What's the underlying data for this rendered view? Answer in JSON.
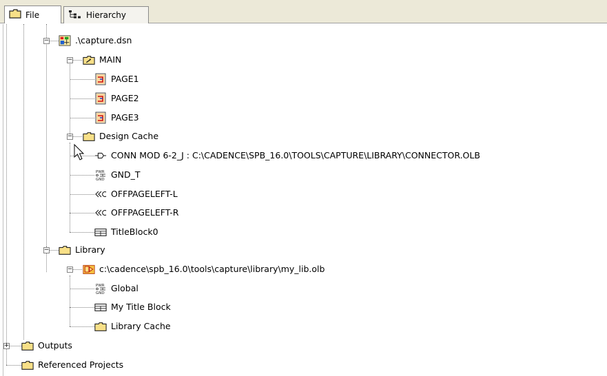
{
  "tabs": [
    {
      "label": "File",
      "icon": "folder-icon"
    },
    {
      "label": "Hierarchy",
      "icon": "hierarchy-icon"
    }
  ],
  "tree": {
    "design": {
      "label": ".\\capture.dsn",
      "icon": "design-icon"
    },
    "main": {
      "label": "MAIN",
      "icon": "schematic-folder-icon"
    },
    "pages": [
      {
        "label": "PAGE1",
        "icon": "page-icon"
      },
      {
        "label": "PAGE2",
        "icon": "page-icon"
      },
      {
        "label": "PAGE3",
        "icon": "page-icon"
      }
    ],
    "design_cache": {
      "label": "Design Cache",
      "icon": "folder-icon"
    },
    "cache_items": [
      {
        "label": "CONN MOD 6-2_J : C:\\CADENCE\\SPB_16.0\\TOOLS\\CAPTURE\\LIBRARY\\CONNECTOR.OLB",
        "icon": "connector-icon"
      },
      {
        "label": "GND_T",
        "icon": "power-ground-icon"
      },
      {
        "label": "OFFPAGELEFT-L",
        "icon": "offpage-icon"
      },
      {
        "label": "OFFPAGELEFT-R",
        "icon": "offpage-icon"
      },
      {
        "label": "TitleBlock0",
        "icon": "title-block-icon"
      }
    ],
    "library": {
      "label": "Library",
      "icon": "folder-icon"
    },
    "library_file": {
      "label": "c:\\cadence\\spb_16.0\\tools\\capture\\library\\my_lib.olb",
      "icon": "library-file-icon"
    },
    "library_items": [
      {
        "label": "Global",
        "icon": "power-ground-icon"
      },
      {
        "label": "My Title Block",
        "icon": "title-block-icon"
      },
      {
        "label": "Library Cache",
        "icon": "folder-icon"
      }
    ],
    "outputs": {
      "label": "Outputs",
      "icon": "folder-icon"
    },
    "referenced": {
      "label": "Referenced Projects",
      "icon": "folder-icon"
    }
  },
  "colors": {
    "folder": "#f8e088",
    "folder_border": "#1a1a1a",
    "tab_bar": "#ece9d8"
  }
}
